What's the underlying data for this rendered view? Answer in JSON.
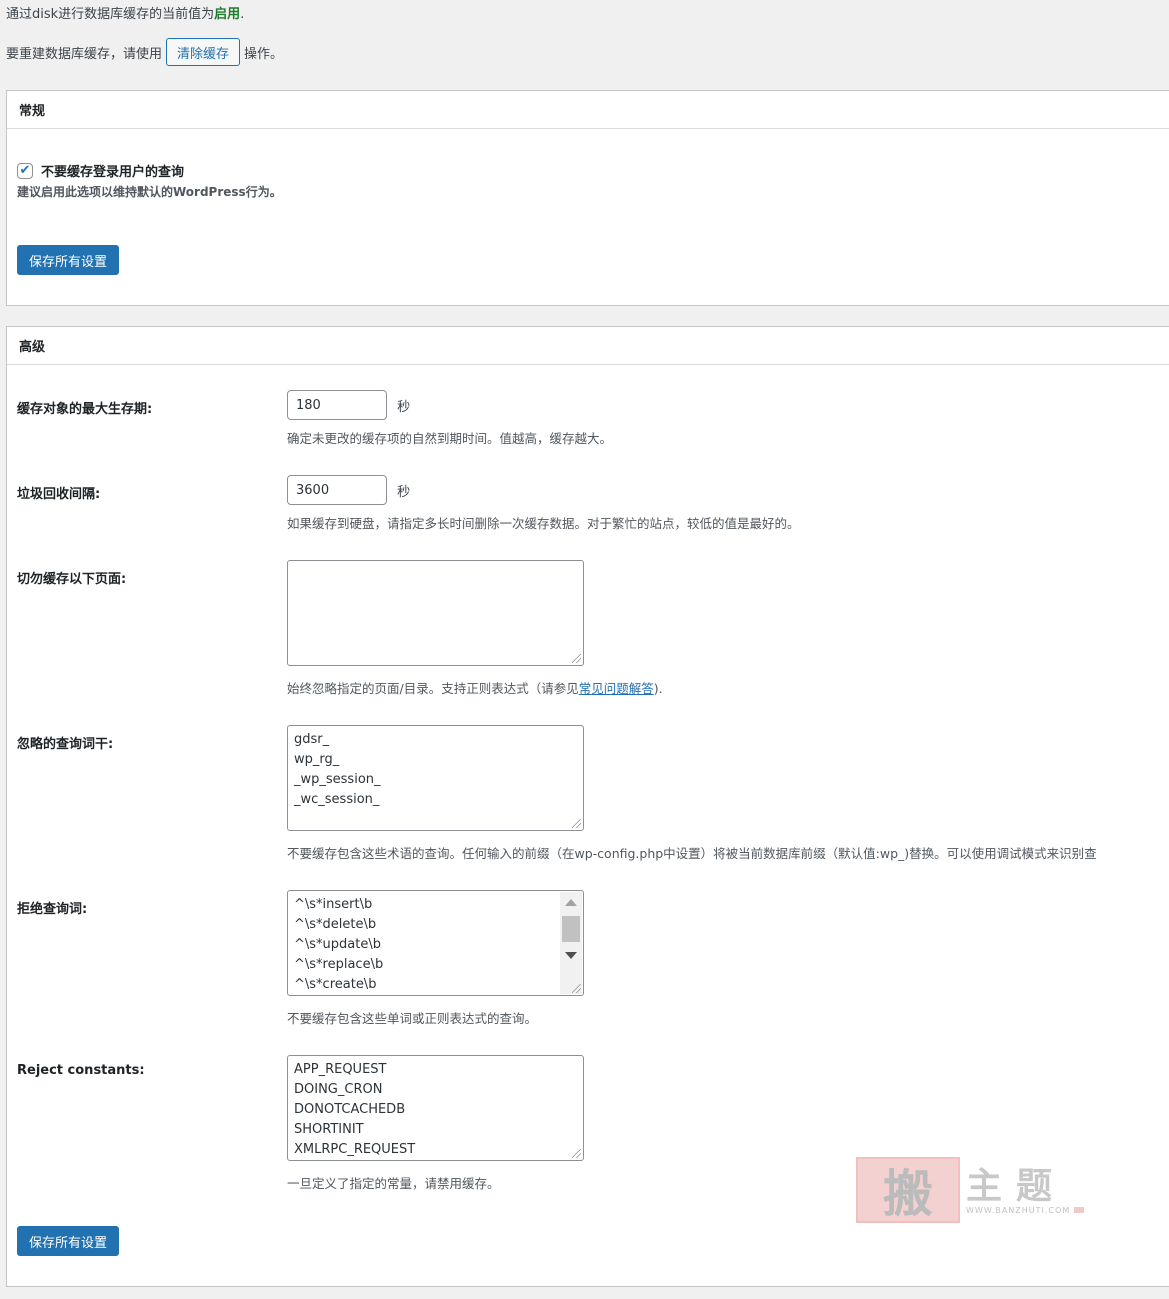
{
  "status": {
    "prefix": "通过disk进行数据库缓存的当前值为",
    "value": "启用",
    "suffix": "."
  },
  "rebuild": {
    "prefix": "要重建数据库缓存，请使用",
    "button": "清除缓存",
    "suffix": "操作。"
  },
  "general": {
    "title": "常规",
    "checkbox_label": "不要缓存登录用户的查询",
    "checkbox_checked": true,
    "checkbox_desc": "建议启用此选项以维持默认的WordPress行为。",
    "save_label": "保存所有设置"
  },
  "advanced": {
    "title": "高级",
    "lifetime": {
      "label": "缓存对象的最大生存期:",
      "value": "180",
      "unit": "秒",
      "help": "确定未更改的缓存项的自然到期时间。值越高，缓存越大。"
    },
    "gc": {
      "label": "垃圾回收间隔:",
      "value": "3600",
      "unit": "秒",
      "help": "如果缓存到硬盘，请指定多长时间删除一次缓存数据。对于繁忙的站点，较低的值是最好的。"
    },
    "reject_pages": {
      "label": "切勿缓存以下页面:",
      "value": "",
      "help_prefix": "始终忽略指定的页面/目录。支持正则表达式（请参见",
      "help_link": "常见问题解答",
      "help_suffix": ")."
    },
    "ignored_stems": {
      "label": "忽略的查询词干:",
      "lines": [
        "gdsr_",
        "wp_rg_",
        "_wp_session_",
        "_wc_session_"
      ],
      "help": "不要缓存包含这些术语的查询。任何输入的前缀（在wp-config.php中设置）将被当前数据库前缀（默认值:wp_)替换。可以使用调试模式来识别查"
    },
    "reject_words": {
      "label": "拒绝查询词:",
      "lines": [
        "^\\s*insert\\b",
        "^\\s*delete\\b",
        "^\\s*update\\b",
        "^\\s*replace\\b",
        "^\\s*create\\b"
      ],
      "help": "不要缓存包含这些单词或正则表达式的查询。"
    },
    "reject_constants": {
      "label": "Reject constants:",
      "lines": [
        "APP_REQUEST",
        "DOING_CRON",
        "DONOTCACHEDB",
        "SHORTINIT",
        "XMLRPC_REQUEST"
      ],
      "help": "一旦定义了指定的常量，请禁用缓存。"
    },
    "save_label": "保存所有设置"
  },
  "watermark": {
    "seal": "搬",
    "text": "主题",
    "url": "WWW.BANZHUTI.COM"
  },
  "icons": {
    "checkbox": "checkmark-icon"
  }
}
